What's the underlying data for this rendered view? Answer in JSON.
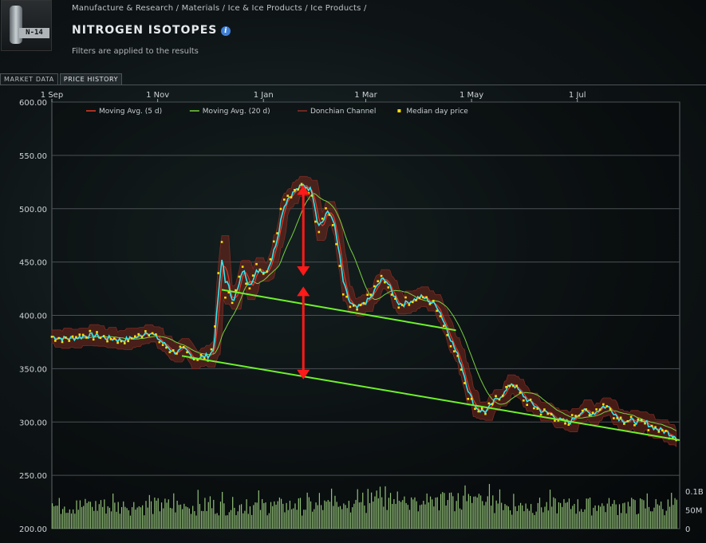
{
  "breadcrumb": "Manufacture & Research / Materials / Ice & Ice Products / Ice Products /",
  "item": {
    "icon_label": "N-14",
    "name": "NITROGEN ISOTOPES",
    "info_glyph": "i"
  },
  "subtitle": "Filters are applied to the results",
  "tabs": [
    {
      "label": "MARKET DATA",
      "active": false
    },
    {
      "label": "PRICE HISTORY",
      "active": true
    }
  ],
  "chart_data": {
    "type": "line",
    "ylim": [
      200,
      600
    ],
    "y_ticks": [
      "600.00",
      "550.00",
      "500.00",
      "450.00",
      "400.00",
      "350.00",
      "300.00",
      "250.00",
      "200.00"
    ],
    "x_ticks": [
      {
        "label": "1 Sep",
        "day": 0
      },
      {
        "label": "1 Nov",
        "day": 61
      },
      {
        "label": "1 Jan",
        "day": 122
      },
      {
        "label": "1 Mar",
        "day": 181
      },
      {
        "label": "1 May",
        "day": 242
      },
      {
        "label": "1 Jul",
        "day": 303
      }
    ],
    "total_days": 362,
    "volume_ticks": [
      "0.1B",
      "50M",
      "0"
    ],
    "legend": [
      {
        "label": "Moving Avg. (5 d)",
        "color": "#e03a2a",
        "kind": "line"
      },
      {
        "label": "Moving Avg. (20 d)",
        "color": "#78d040",
        "kind": "line"
      },
      {
        "label": "Donchian Channel",
        "color": "#8a2e26",
        "kind": "line"
      },
      {
        "label": "Median day price",
        "color": "#ffe000",
        "kind": "square"
      }
    ],
    "price_keypoints": [
      [
        0,
        380
      ],
      [
        10,
        378
      ],
      [
        20,
        382
      ],
      [
        30,
        379
      ],
      [
        40,
        377
      ],
      [
        50,
        380
      ],
      [
        55,
        387
      ],
      [
        60,
        378
      ],
      [
        70,
        365
      ],
      [
        75,
        368
      ],
      [
        80,
        360
      ],
      [
        90,
        362
      ],
      [
        93,
        370
      ],
      [
        96,
        440
      ],
      [
        98,
        468
      ],
      [
        100,
        420
      ],
      [
        105,
        415
      ],
      [
        110,
        448
      ],
      [
        113,
        425
      ],
      [
        118,
        445
      ],
      [
        123,
        440
      ],
      [
        127,
        460
      ],
      [
        130,
        480
      ],
      [
        133,
        508
      ],
      [
        140,
        518
      ],
      [
        145,
        522
      ],
      [
        150,
        516
      ],
      [
        153,
        478
      ],
      [
        158,
        500
      ],
      [
        162,
        488
      ],
      [
        168,
        420
      ],
      [
        172,
        408
      ],
      [
        176,
        405
      ],
      [
        180,
        412
      ],
      [
        184,
        418
      ],
      [
        188,
        432
      ],
      [
        192,
        435
      ],
      [
        196,
        418
      ],
      [
        200,
        410
      ],
      [
        206,
        414
      ],
      [
        212,
        418
      ],
      [
        216,
        414
      ],
      [
        222,
        408
      ],
      [
        225,
        395
      ],
      [
        230,
        375
      ],
      [
        236,
        350
      ],
      [
        240,
        325
      ],
      [
        244,
        312
      ],
      [
        250,
        310
      ],
      [
        255,
        320
      ],
      [
        260,
        328
      ],
      [
        265,
        338
      ],
      [
        270,
        325
      ],
      [
        275,
        318
      ],
      [
        280,
        312
      ],
      [
        285,
        308
      ],
      [
        290,
        305
      ],
      [
        294,
        300
      ],
      [
        298,
        298
      ],
      [
        302,
        308
      ],
      [
        306,
        312
      ],
      [
        310,
        306
      ],
      [
        314,
        312
      ],
      [
        318,
        316
      ],
      [
        322,
        312
      ],
      [
        326,
        304
      ],
      [
        330,
        302
      ],
      [
        336,
        300
      ],
      [
        342,
        298
      ],
      [
        348,
        294
      ],
      [
        354,
        290
      ],
      [
        360,
        287
      ]
    ],
    "trendlines": [
      {
        "from": [
          98,
          424
        ],
        "to": [
          233,
          386
        ]
      },
      {
        "from": [
          75,
          362
        ],
        "to": [
          362,
          283
        ]
      }
    ],
    "arrows": [
      {
        "day": 145,
        "from": 522,
        "to": 437
      },
      {
        "day": 145,
        "from": 427,
        "to": 340
      }
    ]
  }
}
